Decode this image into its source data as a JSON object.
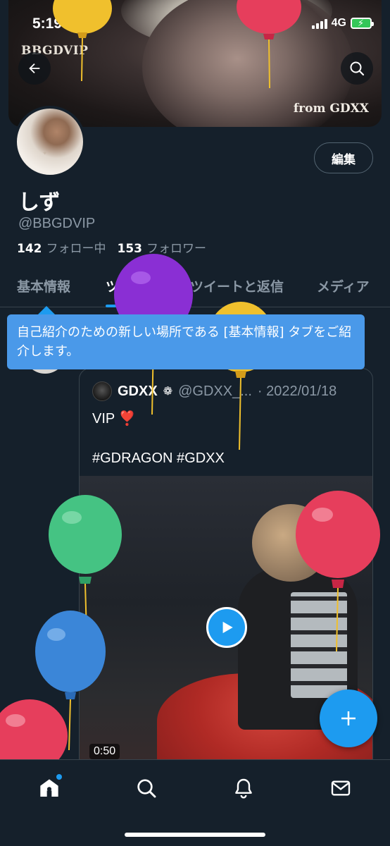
{
  "status_bar": {
    "time": "5:19",
    "network": "4G"
  },
  "banner": {
    "watermark_left": "BBGDVIP",
    "watermark_right": "from GDXX"
  },
  "profile": {
    "edit_label": "編集",
    "display_name": "しず",
    "handle": "@BBGDVIP",
    "following_count": "142",
    "following_label": "フォロー中",
    "followers_count": "153",
    "followers_label": "フォロワー"
  },
  "tabs": [
    {
      "label": "基本情報"
    },
    {
      "label": "ツイート"
    },
    {
      "label": "ツイートと返信"
    },
    {
      "label": "メディア"
    }
  ],
  "tooltip": {
    "text": "自己紹介のための新しい場所である [基本情報] タブをご紹介します。"
  },
  "quote": {
    "name": "GDXX",
    "badge": "❁",
    "handle": "@GDXX_...",
    "date": "· 2022/01/18",
    "text_line1": "VIP ❣️",
    "text_line2": "#GDRAGON #GDXX",
    "video_duration": "0:50"
  },
  "colors": {
    "background": "#15202b",
    "accent": "#1d9bf0",
    "muted_text": "#8b98a5"
  },
  "icons": {
    "back": "arrow-left-icon",
    "search": "search-icon",
    "play": "play-icon",
    "compose": "plus-icon",
    "nav": [
      "home-icon",
      "search-icon",
      "bell-icon",
      "mail-icon"
    ]
  }
}
